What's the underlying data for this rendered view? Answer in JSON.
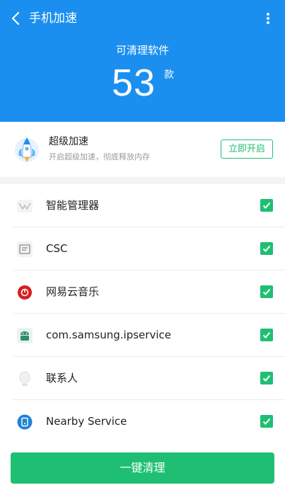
{
  "header": {
    "title": "手机加速",
    "subtitle": "可清理软件",
    "count": "53",
    "count_unit": "款"
  },
  "boost": {
    "title": "超级加速",
    "description": "开启超级加速，彻底释放内存",
    "button_label": "立即开启"
  },
  "apps": [
    {
      "name": "智能管理器",
      "icon": "smart-manager-icon",
      "checked": true
    },
    {
      "name": "CSC",
      "icon": "csc-icon",
      "checked": true
    },
    {
      "name": "网易云音乐",
      "icon": "netease-music-icon",
      "checked": true
    },
    {
      "name": "com.samsung.ipservice",
      "icon": "android-icon",
      "checked": true
    },
    {
      "name": "联系人",
      "icon": "contacts-icon",
      "checked": true
    },
    {
      "name": "Nearby Service",
      "icon": "nearby-service-icon",
      "checked": true
    }
  ],
  "footer": {
    "clean_button_label": "一键清理"
  },
  "colors": {
    "header_bg": "#1a8fef",
    "accent_green": "#1fbf73"
  }
}
